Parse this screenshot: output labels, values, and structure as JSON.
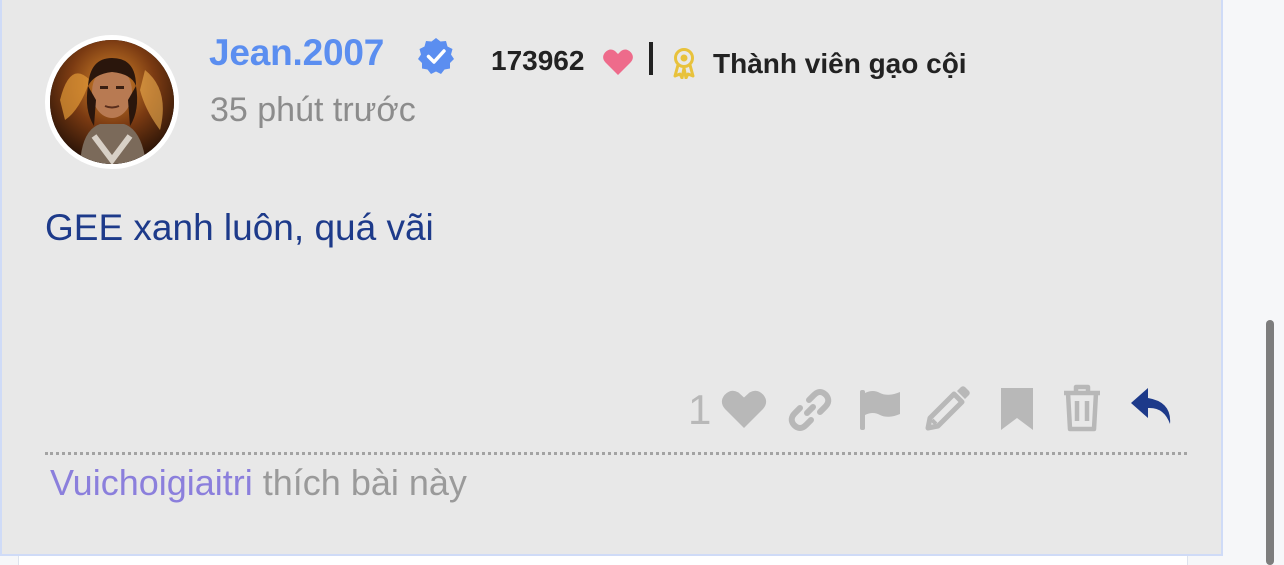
{
  "post": {
    "author": {
      "username": "Jean.2007",
      "verified": true,
      "likes_received": "173962",
      "rank": "Thành viên gạo cội",
      "avatar_icon": "avatar-photo"
    },
    "timestamp": "35 phút trước",
    "content": "GEE xanh luôn, quá vãi",
    "actions": {
      "like_count": "1",
      "icons": [
        "heart-icon",
        "link-icon",
        "flag-icon",
        "edit-icon",
        "bookmark-icon",
        "trash-icon",
        "reply-icon"
      ]
    },
    "liked_by": {
      "user": "Vuichoigiaitri",
      "text": "thích bài này"
    }
  },
  "colors": {
    "username": "#5b8ef0",
    "verified_badge": "#5b8ef0",
    "heart_pink": "#ee6b8b",
    "award": "#e8c23c",
    "body_text": "#1d3a8a",
    "action_icon": "#b8b8b8",
    "reply_icon": "#1d3a8a",
    "liked_user": "#8b7fdc"
  }
}
